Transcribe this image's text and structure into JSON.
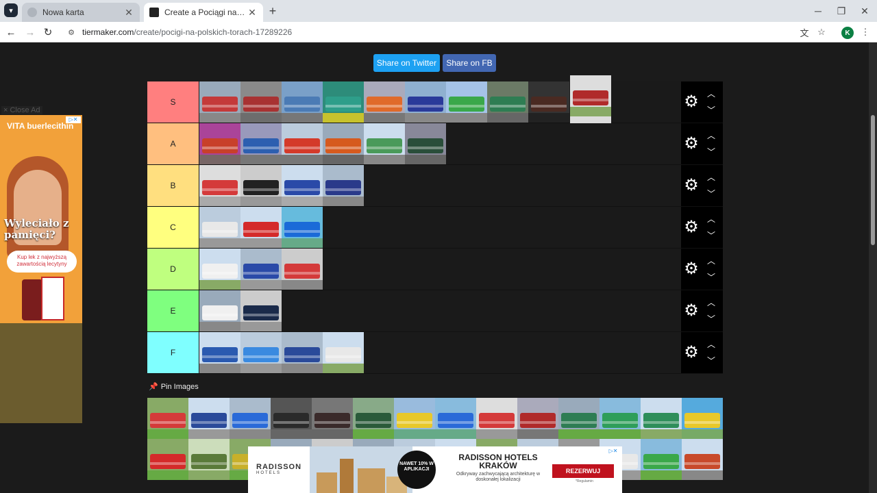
{
  "browser": {
    "tabs": [
      {
        "label": "Nowa karta",
        "active": false
      },
      {
        "label": "Create a Pociągi na Polskich Torach",
        "active": true
      }
    ],
    "url_host": "tiermaker.com",
    "url_path": "/create/pocigi-na-polskich-torach-17289226",
    "profile_initial": "K"
  },
  "share": {
    "twitter_label": "Share on Twitter",
    "fb_label": "Share on FB"
  },
  "tiers": [
    {
      "label": "S",
      "color": "#ff7f7f",
      "items": [
        [
          "#9ab",
          "#c43a3a",
          "#888"
        ],
        [
          "#8a8a8a",
          "#a83232",
          "#6d6d6d"
        ],
        [
          "#7aa0c8",
          "#4b7bb5",
          "#777"
        ],
        [
          "#2d8c7a",
          "#2e9e8a",
          "#c7c22d"
        ],
        [
          "#aab",
          "#e06a2a",
          "#777"
        ],
        [
          "#8fb0d0",
          "#2a3a9a",
          "#888"
        ],
        [
          "#a5c3e8",
          "#3aa84a",
          "#888"
        ],
        [
          "#6b7a66",
          "#2e7d53",
          "#666"
        ],
        [
          "#333",
          "#4a2a22",
          "#222"
        ]
      ]
    },
    {
      "label": "A",
      "color": "#ffbf7f",
      "items": [
        [
          "#a49",
          "#c8402a",
          "#766"
        ],
        [
          "#99b",
          "#2d5fb0",
          "#777"
        ],
        [
          "#bcd",
          "#d43a2a",
          "#777"
        ],
        [
          "#9ab",
          "#d65a1e",
          "#666"
        ],
        [
          "#cde",
          "#4a9a5a",
          "#888"
        ],
        [
          "#889",
          "#2a4e3a",
          "#666"
        ]
      ]
    },
    {
      "label": "B",
      "color": "#ffdf7f",
      "items": [
        [
          "#ddd",
          "#d43a3a",
          "#aaa"
        ],
        [
          "#ccc",
          "#222",
          "#999"
        ],
        [
          "#cde",
          "#2a4aa8",
          "#aaa"
        ],
        [
          "#abc",
          "#2a3a8a",
          "#888"
        ]
      ]
    },
    {
      "label": "C",
      "color": "#ffff7f",
      "items": [
        [
          "#bcd",
          "#e8e8e8",
          "#999"
        ],
        [
          "#cde",
          "#d42a2a",
          "#999"
        ],
        [
          "#6bd",
          "#1a6ad8",
          "#6a8"
        ]
      ]
    },
    {
      "label": "D",
      "color": "#bfff7f",
      "items": [
        [
          "#cde",
          "#f0f0f0",
          "#8a6"
        ],
        [
          "#abc",
          "#2a4aa8",
          "#999"
        ],
        [
          "#ccc",
          "#d43a3a",
          "#888"
        ]
      ]
    },
    {
      "label": "E",
      "color": "#7fff7f",
      "items": [
        [
          "#9ab",
          "#f0f0f0",
          "#888"
        ],
        [
          "#ccc",
          "#1a2a4a",
          "#999"
        ]
      ]
    },
    {
      "label": "F",
      "color": "#7fffff",
      "items": [
        [
          "#cde",
          "#2a5ab0",
          "#888"
        ],
        [
          "#bcd",
          "#3a8ae0",
          "#999"
        ],
        [
          "#abc",
          "#2a4a9a",
          "#888"
        ],
        [
          "#cde",
          "#e8e8e8",
          "#8a6"
        ]
      ]
    }
  ],
  "dragging_item": [
    "#ddd",
    "#b02a2a",
    "#8a6"
  ],
  "pin": {
    "label": "Pin Images"
  },
  "pool_rows": [
    [
      [
        "#8a6",
        "#d43a3a",
        "#6a4"
      ],
      [
        "#cde",
        "#2a4a9a",
        "#999"
      ],
      [
        "#abc",
        "#2a6ad8",
        "#888"
      ],
      [
        "#555",
        "#2a2a2a",
        "#666"
      ],
      [
        "#777",
        "#3a2a2a",
        "#666"
      ],
      [
        "#8a8",
        "#2a5a3a",
        "#6a4"
      ],
      [
        "#9bd",
        "#e8c82a",
        "#6a8"
      ],
      [
        "#8bd",
        "#2a6ad8",
        "#6a8"
      ],
      [
        "#ddd",
        "#d43a3a",
        "#999"
      ],
      [
        "#aab",
        "#b02a2a",
        "#777"
      ],
      [
        "#9ab",
        "#2e7d53",
        "#6a4"
      ],
      [
        "#8bd",
        "#2e9e5a",
        "#6a4"
      ],
      [
        "#cde",
        "#2e8e5a",
        "#8a6"
      ],
      [
        "#5ad",
        "#e8c82a",
        "#7a6"
      ]
    ],
    [
      [
        "#8a6",
        "#d42a2a",
        "#6a4"
      ],
      [
        "#cdb",
        "#5a7a3a",
        "#8a6"
      ],
      [
        "#8a6",
        "#c8b02a",
        "#6a4"
      ],
      [
        "#9ab",
        "#2a4a9a",
        "#888"
      ],
      [
        "#ccc",
        "#d43a3a",
        "#999"
      ],
      [
        "#9ab",
        "#3a6aa8",
        "#888"
      ],
      [
        "#bcd",
        "#2a2a2a",
        "#888"
      ],
      [
        "#cde",
        "#4a6a9a",
        "#999"
      ],
      [
        "#8a6",
        "#6a5a2a",
        "#6a4"
      ],
      [
        "#bcd",
        "#3a7ab0",
        "#888"
      ],
      [
        "#999",
        "#b02a2a",
        "#777"
      ],
      [
        "#cde",
        "#e8e8e8",
        "#999"
      ],
      [
        "#8bd",
        "#3aa84a",
        "#6a4"
      ],
      [
        "#cde",
        "#c84a2a",
        "#888"
      ]
    ]
  ],
  "side_ad": {
    "close_label": "× Close Ad",
    "brand": "VITA buerlecithin",
    "headline": "Wyleciało z pamięci?",
    "cta": "Kup lek z najwyższą zawartością lecytyny"
  },
  "bottom_ad": {
    "logo": "RADISSON",
    "logo_sub": "HOTELS",
    "badge": "NAWET 10% W APLIKACJI",
    "title": "RADISSON HOTELS KRAKÓW",
    "desc": "Odkryway zachwycającą architekturę w doskonałej lokalizacji",
    "button": "REZERWUJ",
    "note": "*Regulamin"
  }
}
